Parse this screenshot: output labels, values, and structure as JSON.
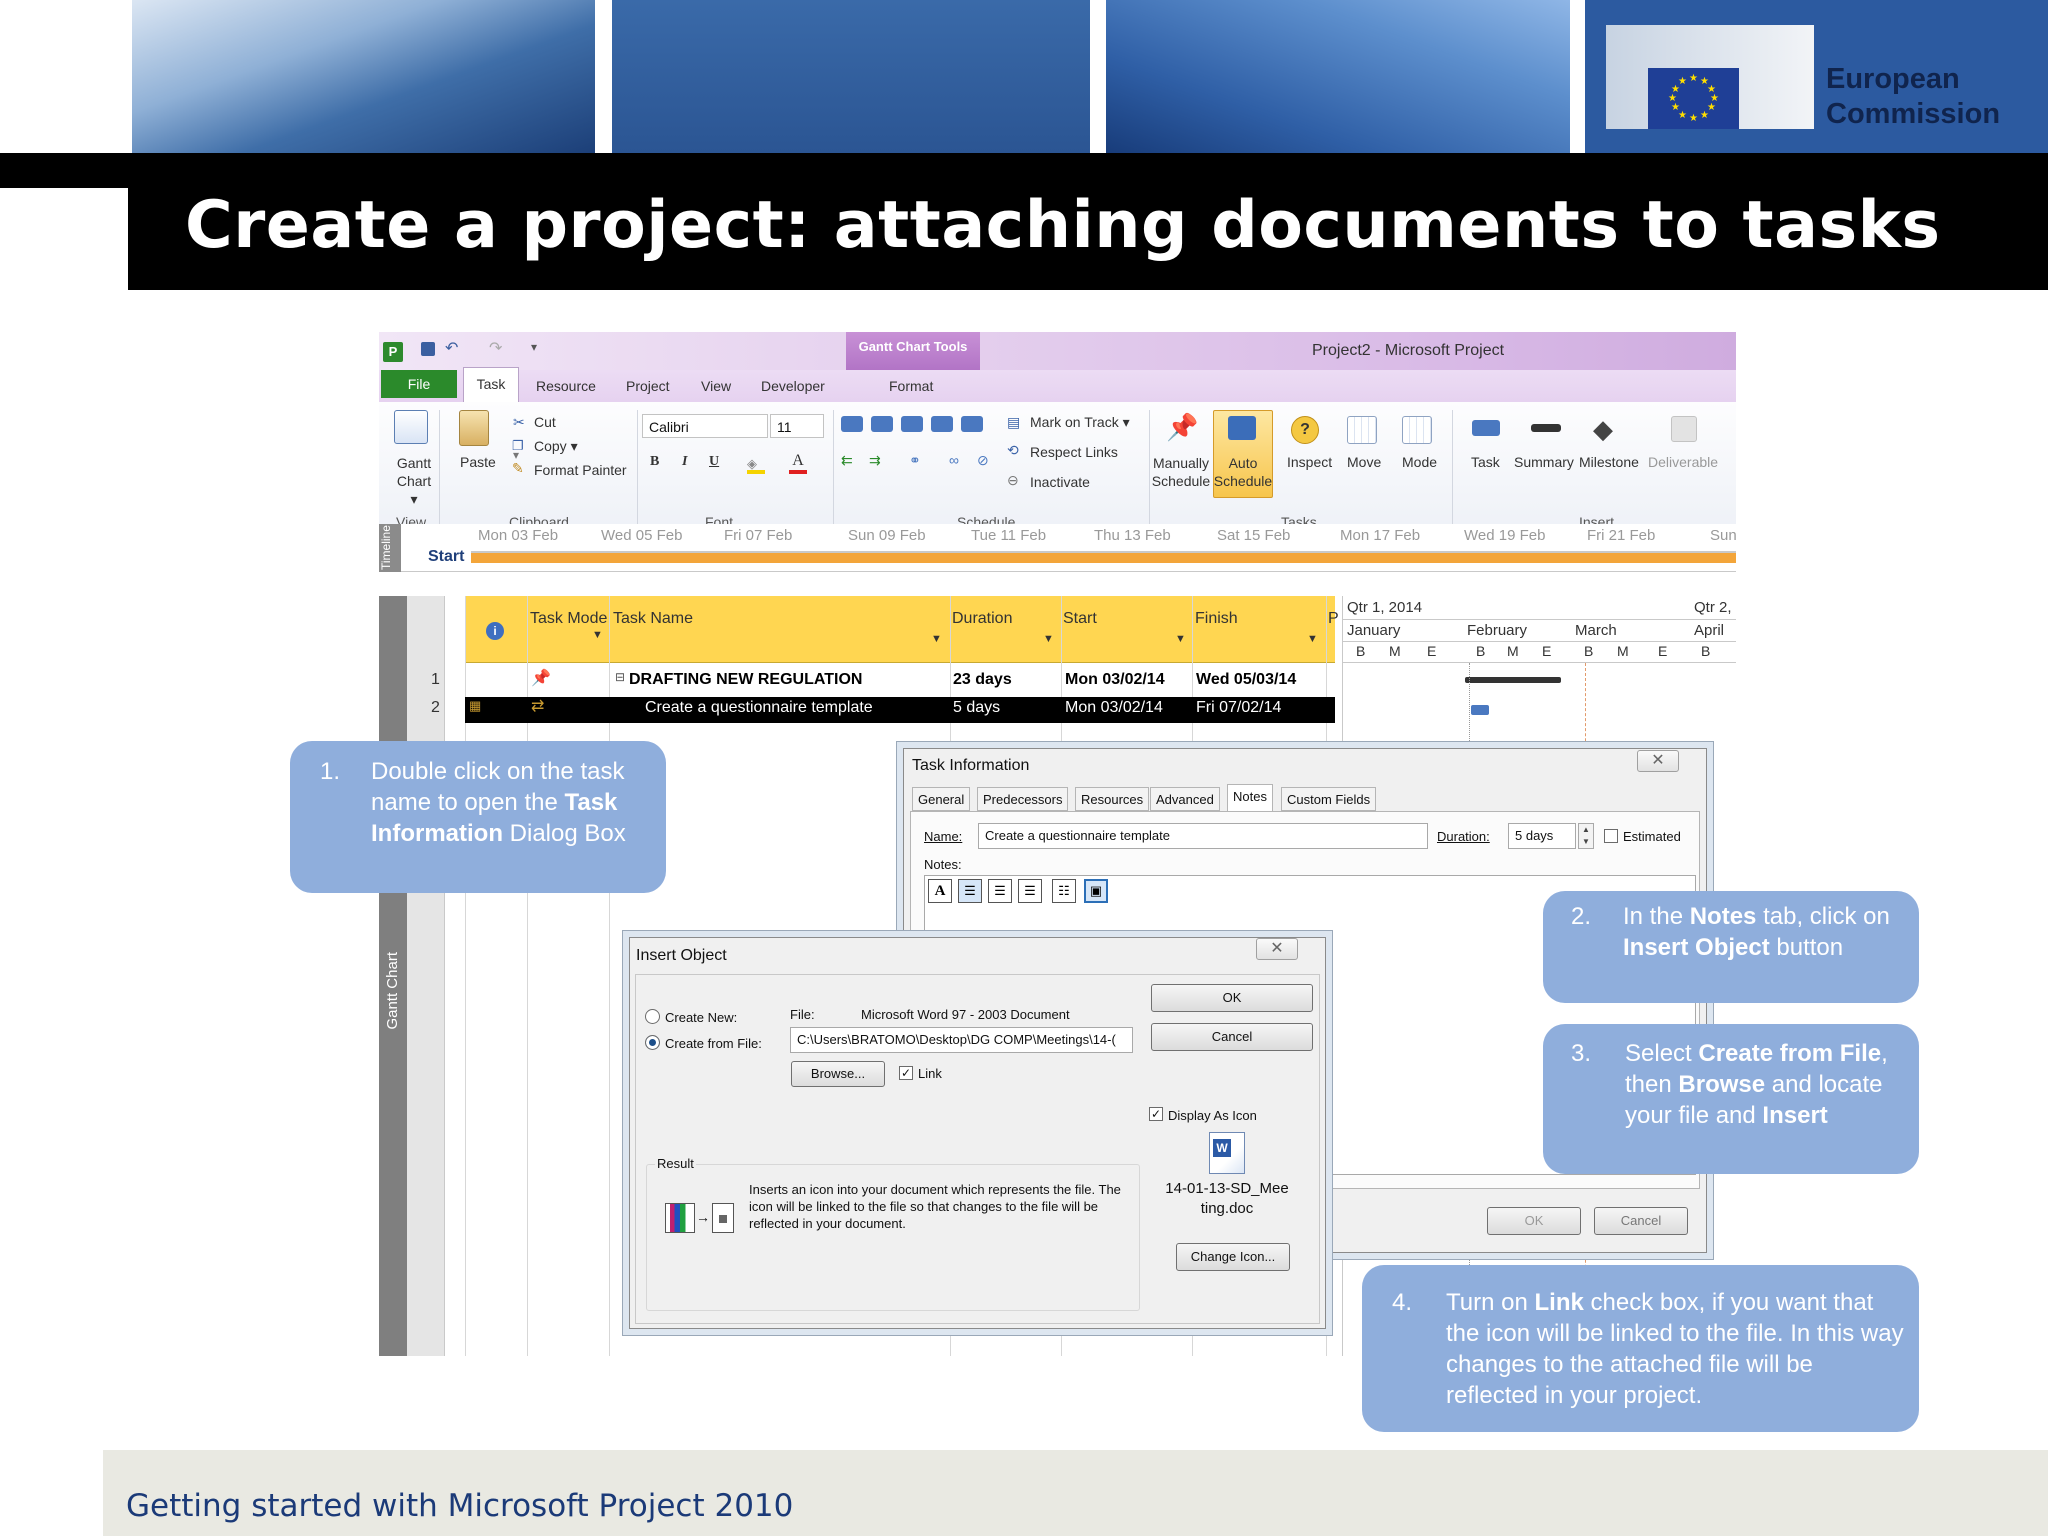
{
  "header": {
    "org_line1": "European",
    "org_line2": "Commission",
    "slide_title": "Create a project: attaching documents to tasks"
  },
  "footer": {
    "text": "Getting started with Microsoft Project 2010"
  },
  "project": {
    "window_title": "Project2  -  Microsoft Project",
    "contextual_tab": "Gantt Chart Tools",
    "menu_tabs": {
      "file": "File",
      "task": "Task",
      "resource": "Resource",
      "project": "Project",
      "view": "View",
      "developer": "Developer",
      "format": "Format"
    },
    "ribbon": {
      "gantt_chart": "Gantt Chart ▾",
      "paste": "Paste",
      "cut": "Cut",
      "copy": "Copy ▾",
      "format_painter": "Format Painter",
      "font_name": "Calibri",
      "font_size": "11",
      "bold": "B",
      "italic": "I",
      "underline": "U",
      "mark_on_track": "Mark on Track ▾",
      "respect_links": "Respect Links",
      "inactivate": "Inactivate",
      "manually_schedule": "Manually Schedule",
      "auto_schedule": "Auto Schedule",
      "inspect": "Inspect",
      "move": "Move",
      "mode": "Mode",
      "task": "Task",
      "summary": "Summary",
      "milestone": "Milestone",
      "deliverable": "Deliverable",
      "groups": {
        "view": "View",
        "clipboard": "Clipboard",
        "font": "Font",
        "schedule": "Schedule",
        "tasks": "Tasks",
        "insert": "Insert"
      }
    },
    "timeline": {
      "side_label": "Timeline",
      "start": "Start",
      "dates": [
        "Mon 03 Feb",
        "Wed 05 Feb",
        "Fri 07 Feb",
        "Sun 09 Feb",
        "Tue 11 Feb",
        "Thu 13 Feb",
        "Sat 15 Feb",
        "Mon 17 Feb",
        "Wed 19 Feb",
        "Fri 21 Feb",
        "Sun"
      ]
    },
    "side_label": "Gantt Chart",
    "columns": {
      "task_mode": "Task Mode",
      "task_name": "Task Name",
      "duration": "Duration",
      "start": "Start",
      "finish": "Finish",
      "p": "P"
    },
    "rows": [
      {
        "num": "1",
        "name": "DRAFTING NEW REGULATION",
        "duration": "23 days",
        "start": "Mon 03/02/14",
        "finish": "Wed 05/03/14"
      },
      {
        "num": "2",
        "name": "Create a questionnaire template",
        "duration": "5 days",
        "start": "Mon 03/02/14",
        "finish": "Fri 07/02/14"
      }
    ],
    "gantt_header": {
      "qtr1": "Qtr 1, 2014",
      "qtr2": "Qtr 2,",
      "months": [
        "January",
        "February",
        "March",
        "April"
      ],
      "subs": [
        "B",
        "M",
        "E",
        "B",
        "M",
        "E",
        "B",
        "M",
        "E",
        "B"
      ]
    }
  },
  "task_info": {
    "title": "Task Information",
    "tabs": [
      "General",
      "Predecessors",
      "Resources",
      "Advanced",
      "Notes",
      "Custom Fields"
    ],
    "name_label": "Name:",
    "name_value": "Create a questionnaire template",
    "duration_label": "Duration:",
    "duration_value": "5 days",
    "estimated_label": "Estimated",
    "notes_label": "Notes:",
    "ok": "OK",
    "cancel": "Cancel"
  },
  "insert_object": {
    "title": "Insert Object",
    "create_new": "Create New:",
    "create_from_file": "Create from File:",
    "file_label": "File:",
    "file_type": "Microsoft Word 97 - 2003 Document",
    "file_path": "C:\\Users\\BRATOMO\\Desktop\\DG COMP\\Meetings\\14-(",
    "browse": "Browse...",
    "link": "Link",
    "ok": "OK",
    "cancel": "Cancel",
    "display_as_icon": "Display As Icon",
    "icon_caption_line1": "14-01-13-SD_Mee",
    "icon_caption_line2": "ting.doc",
    "change_icon": "Change Icon...",
    "result_label": "Result",
    "result_text": "Inserts an icon into your document which represents the file.  The icon will be linked to the file so that changes to the file will be reflected in your document."
  },
  "callouts": {
    "c1": {
      "num": "1.",
      "t1": "Double click on the task name to open the ",
      "b1": "Task Information",
      "t2": " Dialog Box"
    },
    "c2": {
      "num": "2.",
      "t1": "In the ",
      "b1": "Notes",
      "t2": " tab, click on ",
      "b2": "Insert Object",
      "t3": " button"
    },
    "c3": {
      "num": "3.",
      "t1": "Select ",
      "b1": "Create from File",
      "t2": ", then ",
      "b2": "Browse",
      "t3": " and locate your file and ",
      "b3": "Insert"
    },
    "c4": {
      "num": "4.",
      "t1": "Turn on ",
      "b1": "Link",
      "t2": " check box, if you want that the icon will be linked to the file. In this way changes to the attached file will be  reflected in your project."
    }
  },
  "colors": {
    "title_bar": "#000000",
    "callout": "#8faedc",
    "table_header": "#ffd651",
    "brand_blue": "#2c5aa0"
  }
}
